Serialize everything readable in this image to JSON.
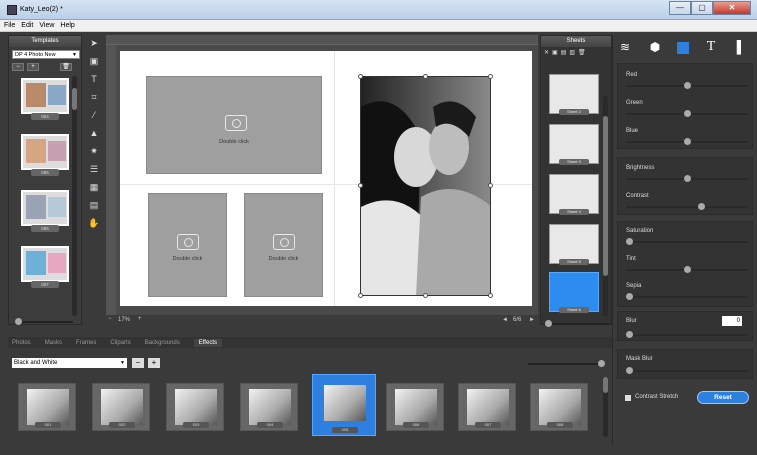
{
  "window": {
    "title": "Katy_Leo(2) *",
    "buttons": [
      "—",
      "▢",
      "✕"
    ]
  },
  "menu": {
    "items": [
      "File",
      "Edit",
      "View",
      "Help"
    ]
  },
  "templates": {
    "header": "Templates",
    "category": "DP 4 Photo New",
    "tools": [
      "−",
      "+",
      "🗑"
    ],
    "items": [
      {
        "label": "004"
      },
      {
        "label": "005"
      },
      {
        "label": "006"
      },
      {
        "label": "007"
      }
    ]
  },
  "canvas": {
    "placeholder": "Double click",
    "zoom_minus": "−",
    "zoom_label": "17%",
    "zoom_plus": "+",
    "page_nav": {
      "prev": "◄",
      "label": "6/6",
      "next": "►"
    }
  },
  "sheets": {
    "header": "Sheets",
    "tools": [
      "✕",
      "▣",
      "▤",
      "▥",
      "🗑"
    ],
    "items": [
      {
        "label": "Sheet 2",
        "selected": false
      },
      {
        "label": "Sheet 3",
        "selected": false
      },
      {
        "label": "Sheet 4",
        "selected": false
      },
      {
        "label": "Sheet 5",
        "selected": false
      },
      {
        "label": "Sheet 6",
        "selected": true
      }
    ]
  },
  "adjust": {
    "tabs": [
      "layers",
      "3d-box",
      "adjust",
      "T",
      "panel"
    ],
    "groups": {
      "color": [
        "Red",
        "Green",
        "Blue"
      ],
      "tone": [
        "Brightness",
        "Contrast"
      ],
      "tint": [
        "Saturation",
        "Tint",
        "Sepia"
      ],
      "blur_label": "Blur",
      "blur_value": "0",
      "mask_blur": "Mask Blur"
    },
    "contrast_stretch": "Contrast Stretch",
    "reset": "Reset"
  },
  "bottom": {
    "tabs": [
      {
        "label": "Photos",
        "icon": "photo-icon",
        "active": false
      },
      {
        "label": "Masks",
        "icon": "mask-icon",
        "active": false
      },
      {
        "label": "Frames",
        "icon": "frame-icon",
        "active": false
      },
      {
        "label": "Cliparts",
        "icon": "star-icon",
        "active": false
      },
      {
        "label": "Backgrounds",
        "icon": "background-icon",
        "active": false
      },
      {
        "label": "Effects",
        "icon": "fx-icon",
        "active": true
      }
    ],
    "effect": "Black and White",
    "minus": "−",
    "plus": "+",
    "thumbs": [
      {
        "label": "001",
        "selected": false
      },
      {
        "label": "002",
        "selected": false
      },
      {
        "label": "003",
        "selected": false
      },
      {
        "label": "004",
        "selected": false
      },
      {
        "label": "005",
        "selected": true
      },
      {
        "label": "006",
        "selected": false
      },
      {
        "label": "007",
        "selected": false
      },
      {
        "label": "008",
        "selected": false
      }
    ]
  },
  "colors": {
    "accent": "#2d7fe0",
    "panel": "#3a3a3a",
    "page": "#ffffff"
  }
}
